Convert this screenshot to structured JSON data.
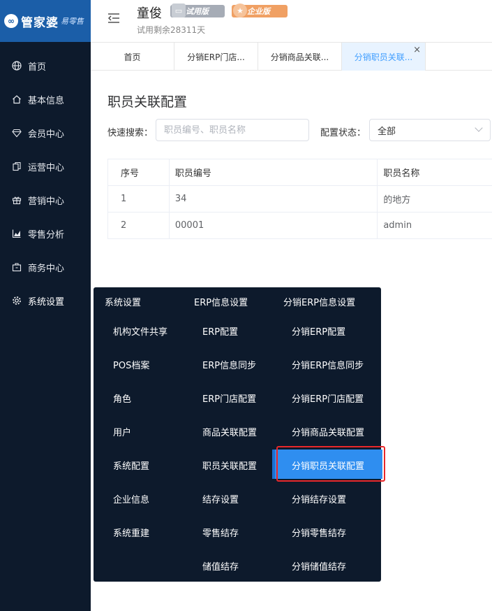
{
  "logo": {
    "brand": "管家婆",
    "sub": "易零售"
  },
  "sidebar": {
    "items": [
      {
        "label": "首页",
        "icon": "globe-icon"
      },
      {
        "label": "基本信息",
        "icon": "home-icon"
      },
      {
        "label": "会员中心",
        "icon": "diamond-icon"
      },
      {
        "label": "运营中心",
        "icon": "documents-icon"
      },
      {
        "label": "营销中心",
        "icon": "gift-icon"
      },
      {
        "label": "零售分析",
        "icon": "chart-icon"
      },
      {
        "label": "商务中心",
        "icon": "briefcase-icon"
      },
      {
        "label": "系统设置",
        "icon": "gear-icon"
      }
    ]
  },
  "header": {
    "user_name": "童俊",
    "trial_badge": "试用版",
    "enterprise_badge": "企业版",
    "trial_remaining": "试用剩余28311天"
  },
  "tabs": [
    {
      "label": "首页"
    },
    {
      "label": "分销ERP门店..."
    },
    {
      "label": "分销商品关联..."
    },
    {
      "label": "分销职员关联...",
      "active": true
    }
  ],
  "main": {
    "title": "职员关联配置",
    "search_label": "快速搜索：",
    "search_placeholder": "职员编号、职员名称",
    "status_label": "配置状态：",
    "status_value": "全部",
    "table": {
      "headers": [
        "序号",
        "职员编号",
        "职员名称"
      ],
      "rows": [
        [
          "1",
          "34",
          "的地方"
        ],
        [
          "2",
          "00001",
          "admin"
        ]
      ]
    }
  },
  "flyout": {
    "col1": {
      "header": "系统设置",
      "items": [
        "机构文件共享",
        "POS档案",
        "角色",
        "用户",
        "系统配置",
        "企业信息",
        "系统重建"
      ]
    },
    "col2": {
      "header": "ERP信息设置",
      "items": [
        "ERP配置",
        "ERP信息同步",
        "ERP门店配置",
        "商品关联配置",
        "职员关联配置",
        "结存设置",
        "零售结存",
        "储值结存"
      ]
    },
    "col3": {
      "header": "分销ERP信息设置",
      "items": [
        "分销ERP配置",
        "分销ERP信息同步",
        "分销ERP门店配置",
        "分销商品关联配置",
        "分销职员关联配置",
        "分销结存设置",
        "分销零售结存",
        "分销储值结存"
      ]
    }
  },
  "colors": {
    "sidebar_bg": "#0d1a2c",
    "logo_bg": "#1b5ea8",
    "accent": "#409eff",
    "highlight": "#2f8ef0",
    "annotation_red": "#e8282b"
  }
}
